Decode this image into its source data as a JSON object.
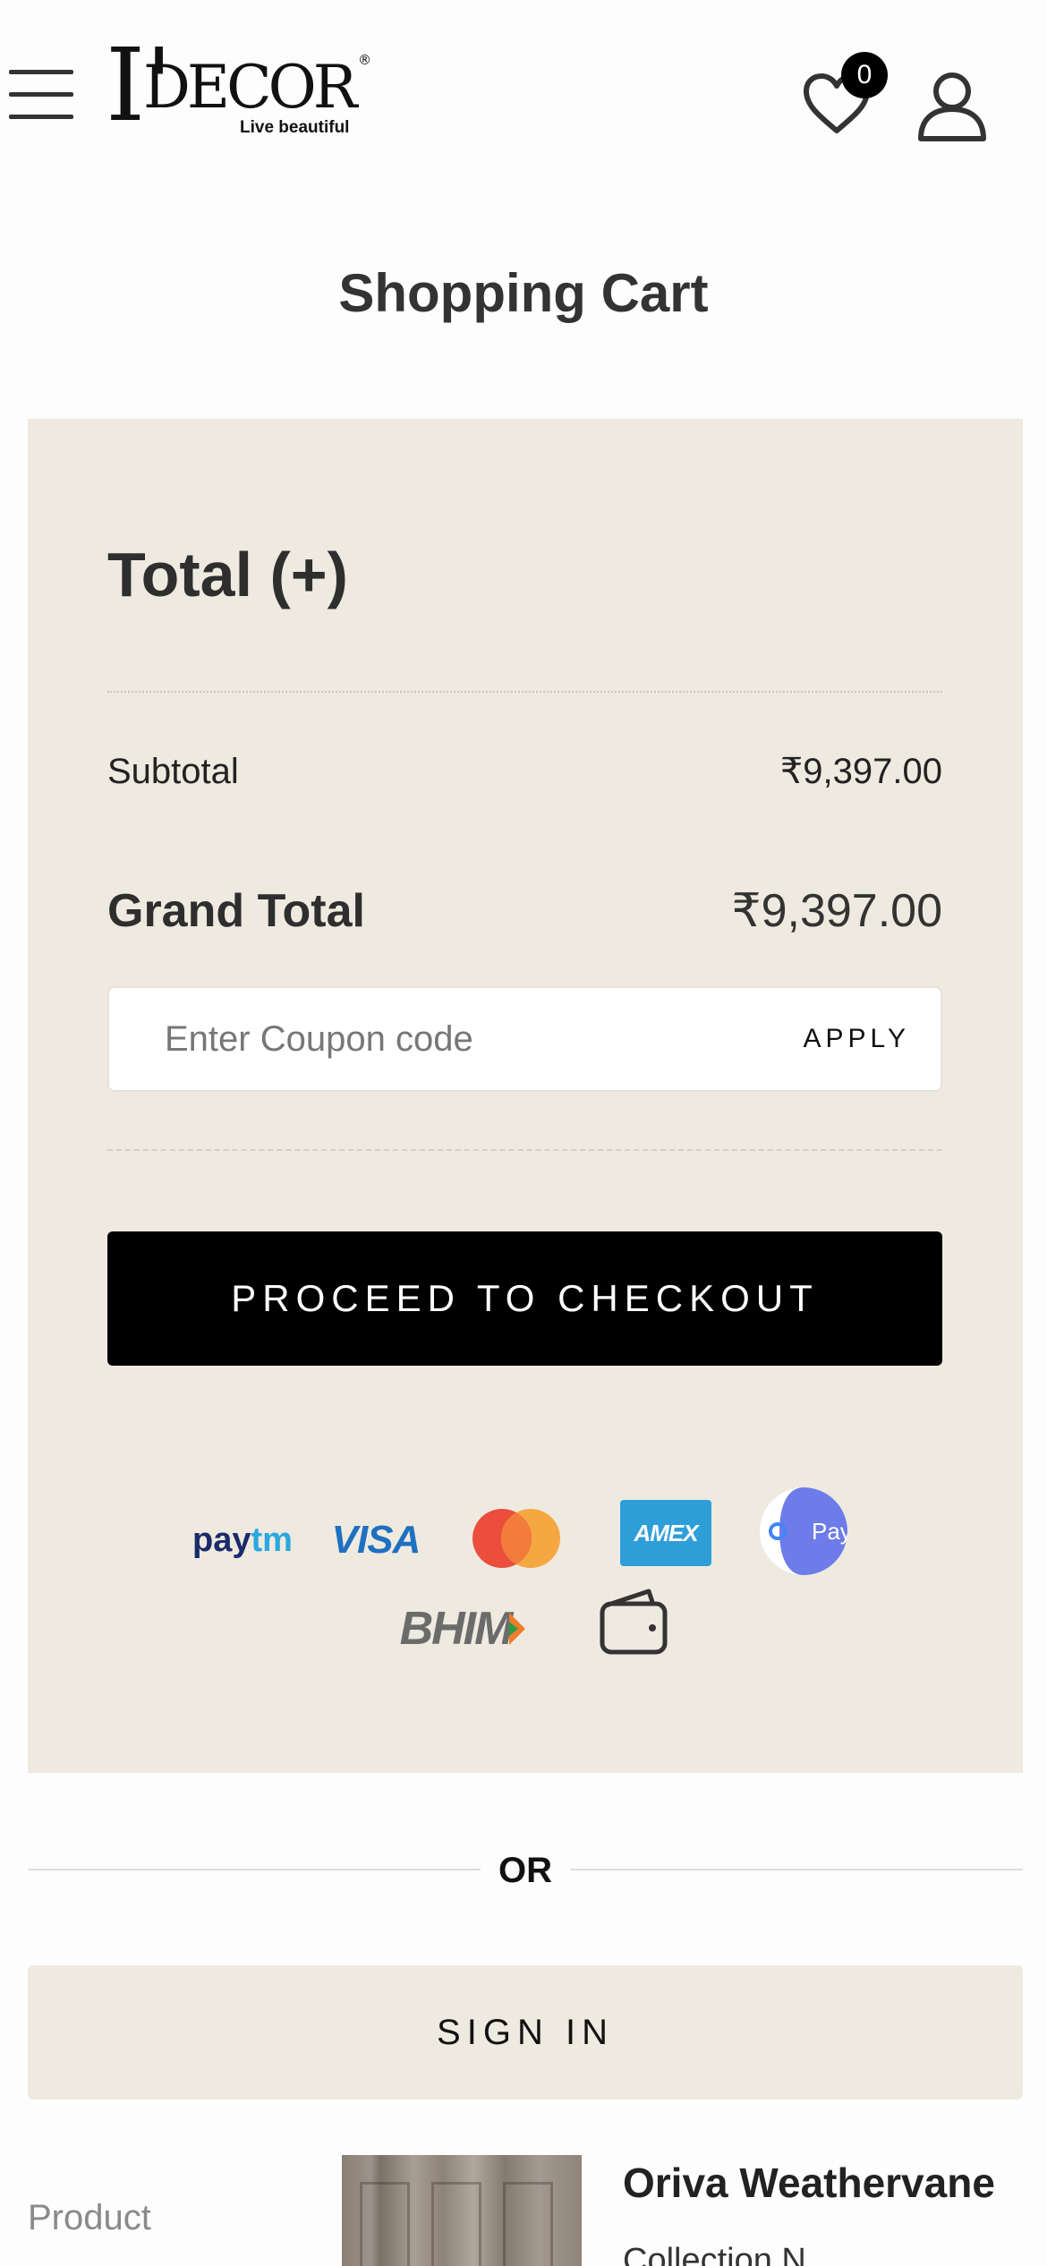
{
  "header": {
    "menu_icon": "hamburger-menu-icon",
    "logo_mark": "I'",
    "logo_word": "DECOR",
    "logo_reg": "®",
    "logo_tagline": "Live beautiful",
    "wishlist_icon": "heart-icon",
    "wishlist_count": "0",
    "account_icon": "user-icon"
  },
  "page": {
    "title": "Shopping Cart"
  },
  "summary": {
    "heading": "Total (+)",
    "subtotal_label": "Subtotal",
    "subtotal_value": "₹9,397.00",
    "grand_total_label": "Grand Total",
    "grand_total_value": "₹9,397.00",
    "coupon_placeholder": "Enter Coupon code",
    "apply_label": "APPLY",
    "checkout_label": "PROCEED TO CHECKOUT",
    "payment_methods": [
      "paytm",
      "visa",
      "mastercard",
      "amex",
      "gpay",
      "bhim",
      "wallet"
    ],
    "paytm_a": "pay",
    "paytm_b": "tm",
    "visa_label": "VISA",
    "amex_label": "AMEX",
    "gpay_label": "Pay",
    "bhim_label": "BHIM"
  },
  "or_label": "OR",
  "signin_label": "SIGN IN",
  "product": {
    "label": "Product",
    "name": "Oriva Weathervane",
    "meta": "Collection N..."
  },
  "colors": {
    "summary_bg": "#eeeae0",
    "checkout_bg": "#000000",
    "badge_bg": "#000000"
  }
}
